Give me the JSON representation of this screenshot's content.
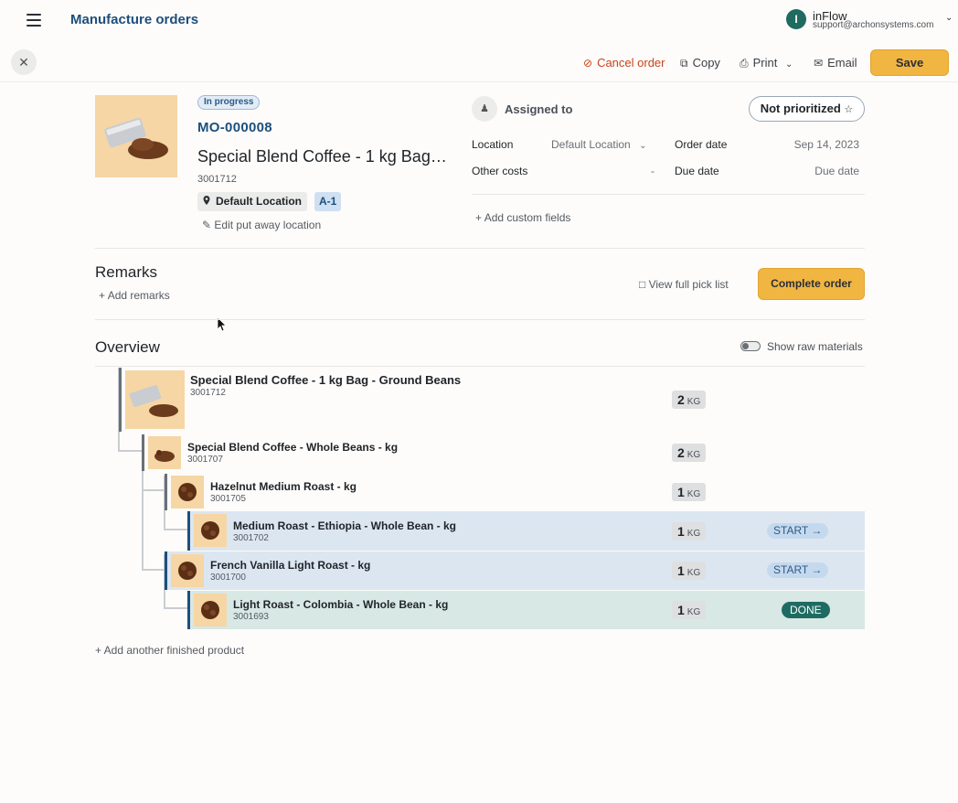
{
  "header": {
    "title": "Manufacture orders",
    "user_initial": "I",
    "user_name": "inFlow",
    "user_email": "support@archonsystems.com"
  },
  "toolbar": {
    "cancel_label": "Cancel order",
    "copy_label": "Copy",
    "print_label": "Print",
    "email_label": "Email",
    "save_label": "Save"
  },
  "order": {
    "status": "In progress",
    "number": "MO-000008",
    "product_name": "Special Blend Coffee - 1 kg Bag - Ground Beans",
    "sku": "3001712",
    "location": "Default Location",
    "sublocation": "A-1",
    "edit_putaway": "Edit put away location",
    "assigned_to_label": "Assigned to",
    "priority": "Not prioritized",
    "location_label": "Location",
    "location_value": "Default Location",
    "order_date_label": "Order date",
    "order_date": "Sep 14, 2023",
    "other_costs_label": "Other costs",
    "other_costs": "-",
    "due_date_label": "Due date",
    "due_date_placeholder": "Due date",
    "add_custom_fields": "Add custom fields"
  },
  "remarks": {
    "title": "Remarks",
    "add_label": "Add remarks",
    "pick_list_label": "View full pick list",
    "complete_label": "Complete order"
  },
  "overview": {
    "title": "Overview",
    "toggle_label": "Show raw materials",
    "rows": [
      {
        "name": "Special Blend Coffee - 1 kg Bag - Ground Beans",
        "sku": "3001712",
        "qty": "2",
        "unit": "KG",
        "action": ""
      },
      {
        "name": "Special Blend Coffee - Whole Beans - kg",
        "sku": "3001707",
        "qty": "2",
        "unit": "KG",
        "action": ""
      },
      {
        "name": "Hazelnut Medium Roast - kg",
        "sku": "3001705",
        "qty": "1",
        "unit": "KG",
        "action": ""
      },
      {
        "name": "Medium Roast - Ethiopia - Whole Bean - kg",
        "sku": "3001702",
        "qty": "1",
        "unit": "KG",
        "action": "START →"
      },
      {
        "name": "French Vanilla Light Roast - kg",
        "sku": "3001700",
        "qty": "1",
        "unit": "KG",
        "action": "START →"
      },
      {
        "name": "Light Roast - Colombia - Whole Bean - kg",
        "sku": "3001693",
        "qty": "1",
        "unit": "KG",
        "action": "DONE"
      }
    ],
    "add_finished_label": "+ Add another finished product"
  },
  "colors": {
    "brand_blue": "#1d4f7c",
    "accent_yellow": "#f1b542",
    "cancel_red": "#c8431c",
    "done_green": "#1e6b62"
  }
}
